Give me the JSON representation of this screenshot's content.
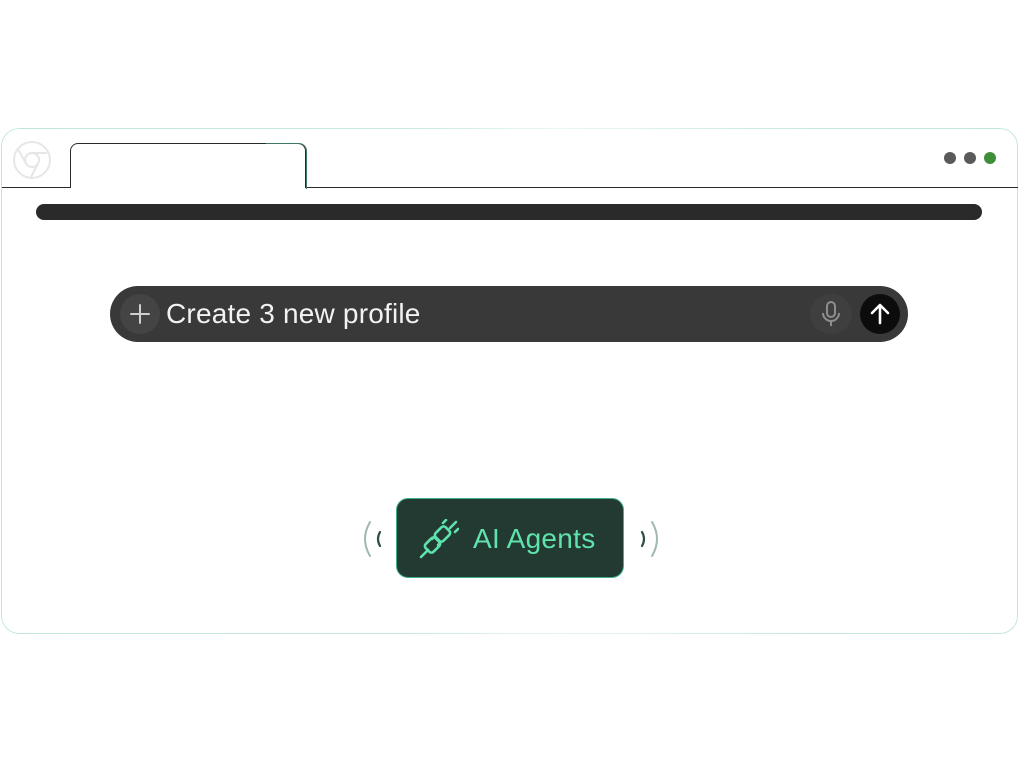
{
  "browser": {
    "logo_icon": "browser-logo-icon",
    "window_controls": [
      "#5a5a5a",
      "#5a5a5a",
      "#3f8f3a"
    ]
  },
  "prompt": {
    "text": "Create 3 new profile",
    "plus_icon": "plus-icon",
    "mic_icon": "microphone-icon",
    "send_icon": "arrow-up-icon"
  },
  "agents_badge": {
    "label": "AI Agents",
    "icon": "plug-icon",
    "accent": "#5fe3ac",
    "background": "#233a33"
  }
}
